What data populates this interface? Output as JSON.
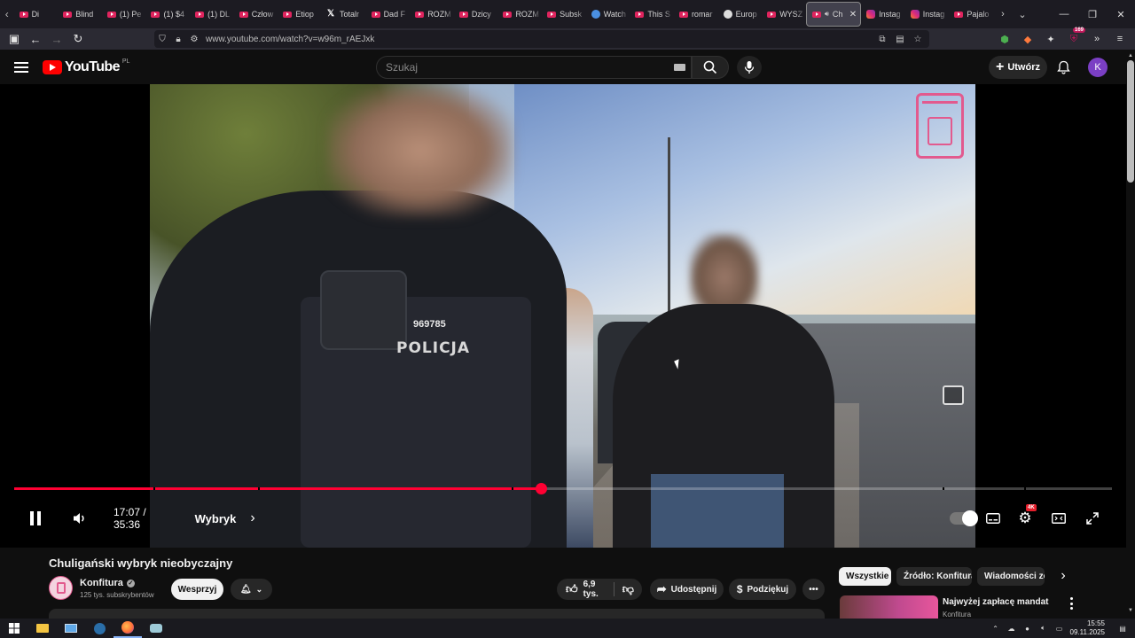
{
  "browser": {
    "tabs": [
      {
        "label": "Di",
        "icon": "youtube-icon"
      },
      {
        "label": "Blind",
        "icon": "youtube-icon"
      },
      {
        "label": "(1) Pe",
        "icon": "youtube-icon"
      },
      {
        "label": "(1) $4",
        "icon": "youtube-icon"
      },
      {
        "label": "(1) DL",
        "icon": "youtube-icon"
      },
      {
        "label": "Człow",
        "icon": "youtube-icon"
      },
      {
        "label": "Etiop",
        "icon": "youtube-icon"
      },
      {
        "label": "Totalr",
        "icon": "x-icon"
      },
      {
        "label": "Dad F",
        "icon": "youtube-icon"
      },
      {
        "label": "ROZM",
        "icon": "youtube-icon"
      },
      {
        "label": "Dzicy",
        "icon": "youtube-icon"
      },
      {
        "label": "ROZM",
        "icon": "youtube-icon"
      },
      {
        "label": "Subsk",
        "icon": "youtube-icon"
      },
      {
        "label": "Watch",
        "icon": "globe-icon"
      },
      {
        "label": "This S",
        "icon": "youtube-icon"
      },
      {
        "label": "romar",
        "icon": "youtube-icon"
      },
      {
        "label": "Europ",
        "icon": "circle-icon"
      },
      {
        "label": "WYSZ",
        "icon": "youtube-icon"
      },
      {
        "label": "Ch",
        "icon": "youtube-icon",
        "active": true
      },
      {
        "label": "Instag",
        "icon": "instagram-icon"
      },
      {
        "label": "Instag",
        "icon": "instagram-icon"
      },
      {
        "label": "Pajalo",
        "icon": "youtube-icon"
      }
    ],
    "url": "www.youtube.com/watch?v=w96m_rAEJxk",
    "extensions_badge": "169"
  },
  "youtube": {
    "logo_text": "YouTube",
    "region": "PL",
    "search_placeholder": "Szukaj",
    "create_label": "Utwórz",
    "avatar_letter": "K"
  },
  "player": {
    "current_time": "17:07",
    "duration": "35:36",
    "time_display": "17:07 / 35:36",
    "chapter": "Wybryk",
    "progress": 0.48,
    "quality_badge": "4K",
    "video_overlay_text": {
      "badge_number": "969785",
      "vest_text": "POLICJA"
    },
    "accent_color": "#ff0033"
  },
  "video_info": {
    "title": "Chuligański wybryk nieobyczajny",
    "channel": "Konfitura",
    "subscribers": "125 tys. subskrybentów",
    "support_label": "Wesprzyj",
    "likes": "6,9 tys.",
    "share_label": "Udostępnij",
    "thanks_label": "Podziękuj"
  },
  "sidebar": {
    "chips": [
      "Wszystkie",
      "Źródło: Konfitura",
      "Wiadomości ze"
    ],
    "rec_title": "Najwyżej zapłacę mandat",
    "rec_channel": "Konfitura"
  },
  "taskbar": {
    "time": "15:55",
    "date": "09.11.2025"
  }
}
